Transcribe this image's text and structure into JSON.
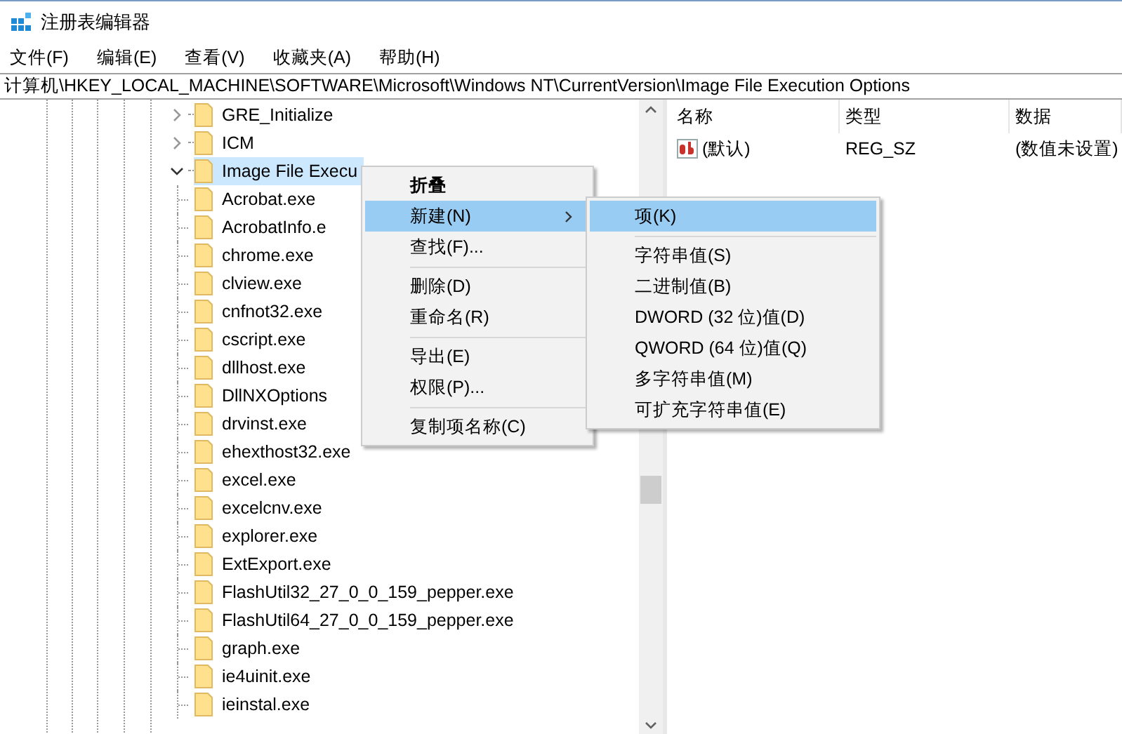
{
  "window": {
    "title": "注册表编辑器"
  },
  "menu_bar": [
    "文件(F)",
    "编辑(E)",
    "查看(V)",
    "收藏夹(A)",
    "帮助(H)"
  ],
  "address_bar": "计算机\\HKEY_LOCAL_MACHINE\\SOFTWARE\\Microsoft\\Windows NT\\CurrentVersion\\Image File Execution Options",
  "tree": [
    {
      "label": "GRE_Initialize",
      "expanded": false,
      "selected": false
    },
    {
      "label": "ICM",
      "expanded": false,
      "selected": false
    },
    {
      "label": "Image File Execu",
      "expanded": true,
      "selected": true,
      "children": [
        {
          "label": "Acrobat.exe",
          "selected": false
        },
        {
          "label": "AcrobatInfo.e",
          "selected": false
        },
        {
          "label": "chrome.exe",
          "selected": false
        },
        {
          "label": "clview.exe",
          "selected": false
        },
        {
          "label": "cnfnot32.exe",
          "selected": false
        },
        {
          "label": "cscript.exe",
          "selected": false
        },
        {
          "label": "dllhost.exe",
          "selected": false
        },
        {
          "label": "DllNXOptions",
          "selected": false
        },
        {
          "label": "drvinst.exe",
          "selected": false
        },
        {
          "label": "ehexthost32.exe",
          "selected": false
        },
        {
          "label": "excel.exe",
          "selected": false
        },
        {
          "label": "excelcnv.exe",
          "selected": false
        },
        {
          "label": "explorer.exe",
          "selected": false
        },
        {
          "label": "ExtExport.exe",
          "selected": false
        },
        {
          "label": "FlashUtil32_27_0_0_159_pepper.exe",
          "selected": false
        },
        {
          "label": "FlashUtil64_27_0_0_159_pepper.exe",
          "selected": false
        },
        {
          "label": "graph.exe",
          "selected": false
        },
        {
          "label": "ie4uinit.exe",
          "selected": false
        },
        {
          "label": "ieinstal.exe",
          "selected": false
        }
      ]
    }
  ],
  "values_list": {
    "columns": [
      "名称",
      "类型",
      "数据"
    ],
    "rows": [
      {
        "name": "(默认)",
        "type": "REG_SZ",
        "data": "(数值未设置)"
      }
    ]
  },
  "context_menu": {
    "items": [
      {
        "kind": "item",
        "label": "折叠",
        "default": true,
        "submenu": false,
        "selected": false
      },
      {
        "kind": "item",
        "label": "新建(N)",
        "default": false,
        "submenu": true,
        "selected": true
      },
      {
        "kind": "item",
        "label": "查找(F)...",
        "default": false,
        "submenu": false,
        "selected": false
      },
      {
        "kind": "separator"
      },
      {
        "kind": "item",
        "label": "删除(D)",
        "default": false,
        "submenu": false,
        "selected": false
      },
      {
        "kind": "item",
        "label": "重命名(R)",
        "default": false,
        "submenu": false,
        "selected": false
      },
      {
        "kind": "separator"
      },
      {
        "kind": "item",
        "label": "导出(E)",
        "default": false,
        "submenu": false,
        "selected": false
      },
      {
        "kind": "item",
        "label": "权限(P)...",
        "default": false,
        "submenu": false,
        "selected": false
      },
      {
        "kind": "separator"
      },
      {
        "kind": "item",
        "label": "复制项名称(C)",
        "default": false,
        "submenu": false,
        "selected": false
      }
    ]
  },
  "submenu": {
    "items": [
      {
        "kind": "item",
        "label": "项(K)",
        "selected": true
      },
      {
        "kind": "separator"
      },
      {
        "kind": "item",
        "label": "字符串值(S)",
        "selected": false
      },
      {
        "kind": "item",
        "label": "二进制值(B)",
        "selected": false
      },
      {
        "kind": "item",
        "label": "DWORD (32 位)值(D)",
        "selected": false
      },
      {
        "kind": "item",
        "label": "QWORD (64 位)值(Q)",
        "selected": false
      },
      {
        "kind": "item",
        "label": "多字符串值(M)",
        "selected": false
      },
      {
        "kind": "item",
        "label": "可扩充字符串值(E)",
        "selected": false
      }
    ]
  }
}
